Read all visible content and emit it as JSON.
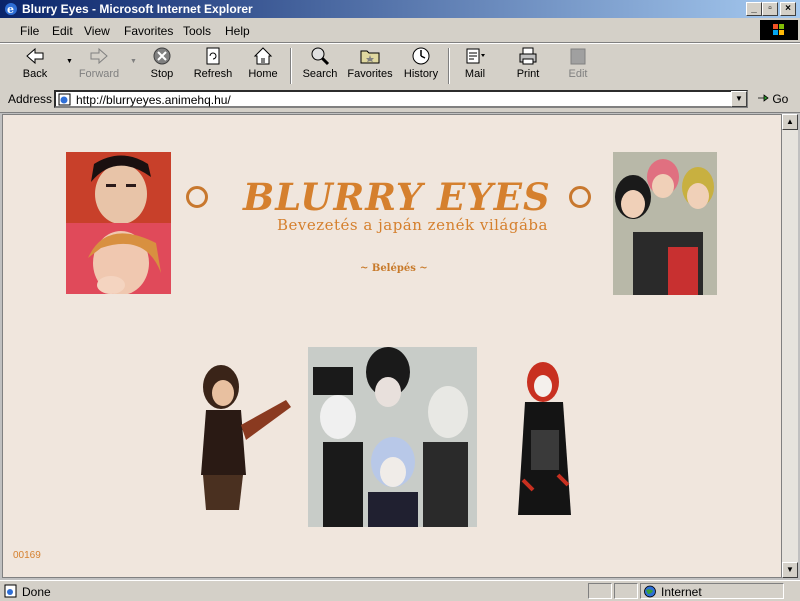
{
  "window": {
    "title": "Blurry Eyes - Microsoft Internet Explorer"
  },
  "menu": [
    {
      "label": "File",
      "ul": "F",
      "rest": "ile"
    },
    {
      "label": "Edit",
      "ul": "E",
      "rest": "dit"
    },
    {
      "label": "View",
      "ul": "V",
      "rest": "iew"
    },
    {
      "label": "Favorites",
      "ul": "F",
      "rest": "a",
      "full": "Favorites"
    },
    {
      "label": "Tools",
      "ul": "T",
      "rest": "ools"
    },
    {
      "label": "Help",
      "ul": "H",
      "rest": "elp"
    }
  ],
  "toolbar": {
    "back": "Back",
    "forward": "Forward",
    "stop": "Stop",
    "refresh": "Refresh",
    "home": "Home",
    "search": "Search",
    "favorites": "Favorites",
    "history": "History",
    "mail": "Mail",
    "print": "Print",
    "edit": "Edit"
  },
  "address": {
    "label": "Address",
    "url": "http://blurryeyes.animehq.hu/",
    "go": "Go"
  },
  "page": {
    "title": "BLURRY EYES",
    "subtitle": "Bevezetés a japán zenék világába",
    "enter_link": "~ Belépés ~",
    "counter": "00169"
  },
  "status": {
    "text": "Done",
    "zone": "Internet"
  },
  "colors": {
    "accent": "#d5802e",
    "page_bg": "#f0e6dd"
  }
}
